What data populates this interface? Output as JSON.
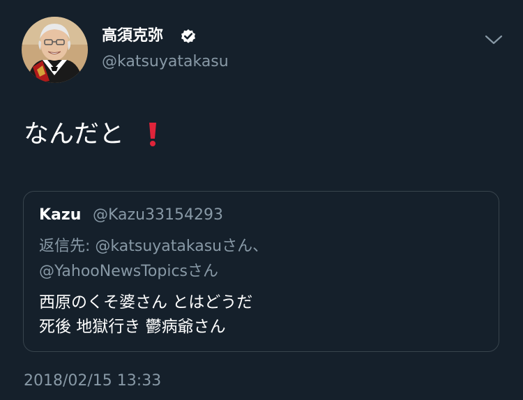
{
  "tweet": {
    "display_name": "高須克弥",
    "handle": "@katsuyatakasu",
    "text": "なんだと",
    "emoji": "exclamation-mark-icon",
    "timestamp": "2018/02/15 13:33"
  },
  "quoted": {
    "name": "Kazu",
    "handle": "@Kazu33154293",
    "reply_line1": "返信先: @katsuyatakasuさん、",
    "reply_line2": "@YahooNewsTopicsさん",
    "text_line1": "西原のくそ婆さん とはどうだ",
    "text_line2": "死後 地獄行き 鬱病爺さん"
  },
  "colors": {
    "background": "#15202b",
    "text_primary": "#ffffff",
    "text_secondary": "#8899a6",
    "border": "#38444d",
    "accent_red": "#e0243a"
  }
}
